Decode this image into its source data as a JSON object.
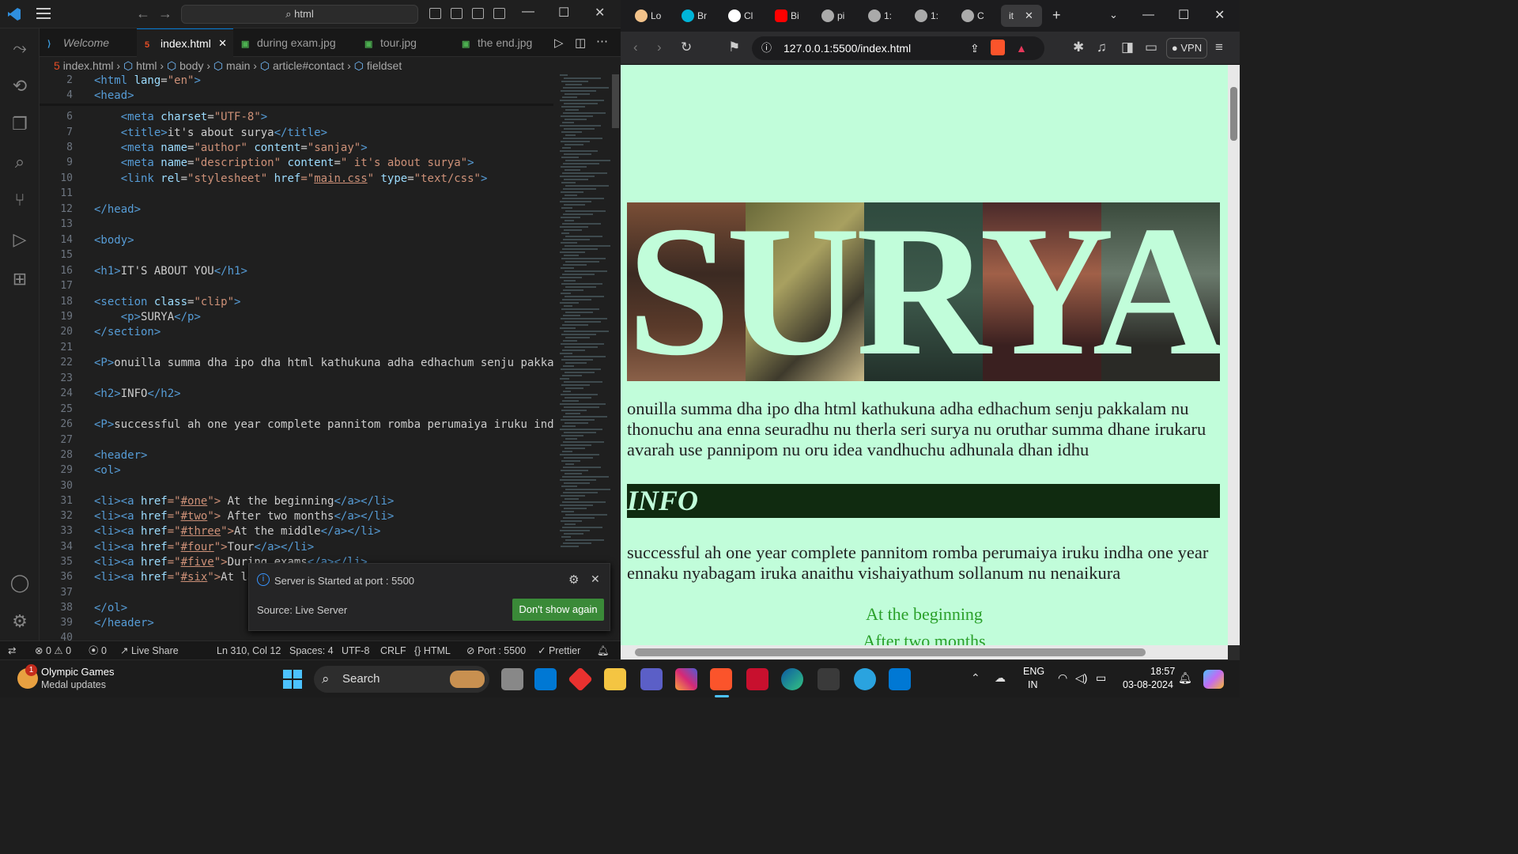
{
  "vscode": {
    "search_text": "html",
    "tabs": [
      {
        "label": "Welcome",
        "icon": "vscode-icon"
      },
      {
        "label": "index.html",
        "icon": "html5-icon",
        "active": true
      },
      {
        "label": "during exam.jpg",
        "icon": "image-icon"
      },
      {
        "label": "tour.jpg",
        "icon": "image-icon"
      },
      {
        "label": "the end.jpg",
        "icon": "image-icon"
      }
    ],
    "breadcrumbs": [
      "index.html",
      "html",
      "body",
      "main",
      "article#contact",
      "fieldset"
    ],
    "line_numbers": [
      "2",
      "4",
      "6",
      "7",
      "8",
      "9",
      "10",
      "11",
      "12",
      "13",
      "14",
      "15",
      "16",
      "17",
      "18",
      "19",
      "20",
      "21",
      "22",
      "23",
      "24",
      "25",
      "26",
      "27",
      "28",
      "29",
      "30",
      "31",
      "32",
      "33",
      "34",
      "35",
      "36",
      "37",
      "38",
      "39",
      "40"
    ],
    "code": {
      "l2": {
        "a": "<html ",
        "b": "lang",
        "c": "=",
        "d": "\"en\"",
        "e": ">"
      },
      "l4": "<head>",
      "l6": {
        "a": "    <meta ",
        "b": "charset",
        "c": "=",
        "d": "\"UTF-8\"",
        "e": ">"
      },
      "l7": {
        "a": "    <title>",
        "b": "it's about surya",
        "c": "</title>"
      },
      "l8": {
        "a": "    <meta ",
        "b": "name",
        "c": "=",
        "d": "\"author\"",
        "e": " content",
        "f": "=",
        "g": "\"sanjay\"",
        "h": ">"
      },
      "l9": {
        "a": "    <meta ",
        "b": "name",
        "c": "=",
        "d": "\"description\"",
        "e": " content",
        "f": "=",
        "g": "\" it's about surya\"",
        "h": ">"
      },
      "l10": {
        "a": "    <link ",
        "b": "rel",
        "c": "=",
        "d": "\"stylesheet\"",
        "e": " href",
        "f": "=\"",
        "g": "main.css",
        "h": "\"",
        "i": " type",
        "j": "=",
        "k": "\"text/css\"",
        "l": ">"
      },
      "l12": "</head>",
      "l14": "<body>",
      "l16": {
        "a": "<h1>",
        "b": "IT'S ABOUT YOU",
        "c": "</h1>"
      },
      "l18": {
        "a": "<section ",
        "b": "class",
        "c": "=",
        "d": "\"clip\"",
        "e": ">"
      },
      "l19": {
        "a": "    <p>",
        "b": "SURYA",
        "c": "</p>"
      },
      "l20": "</section>",
      "l22": {
        "a": "<P>",
        "b": "onuilla summa dha ipo dha html kathukuna adha edhachum senju pakkalam nu"
      },
      "l24": {
        "a": "<h2>",
        "b": "INFO",
        "c": "</h2>"
      },
      "l26": {
        "a": "<P>",
        "b": "successful ah one year complete pannitom romba perumaiya iruku indha one"
      },
      "l28": "<header>",
      "l29": "<ol>",
      "l31": {
        "a": "<li><a ",
        "b": "href",
        "c": "=\"",
        "d": "#one",
        "e": "\">",
        "f": " At the beginning",
        "g": "</a></li>"
      },
      "l32": {
        "a": "<li><a ",
        "b": "href",
        "c": "=\"",
        "d": "#two",
        "e": "\">",
        "f": " After two months",
        "g": "</a></li>"
      },
      "l33": {
        "a": "<li><a ",
        "b": "href",
        "c": "=\"",
        "d": "#three",
        "e": "\">",
        "f": "At the middle",
        "g": "</a></li>"
      },
      "l34": {
        "a": "<li><a ",
        "b": "href",
        "c": "=\"",
        "d": "#four",
        "e": "\">",
        "f": "Tour",
        "g": "</a></li>"
      },
      "l35": {
        "a": "<li><a ",
        "b": "href",
        "c": "=\"",
        "d": "#five",
        "e": "\">",
        "f": "During exams",
        "g": "</a></li>"
      },
      "l36": {
        "a": "<li><a ",
        "b": "href",
        "c": "=\"",
        "d": "#six",
        "e": "\">",
        "f": "At las"
      },
      "l38": "</ol>",
      "l39": "</header>"
    },
    "toast": {
      "message": "Server is Started at port : 5500",
      "source": "Source: Live Server",
      "button": "Don't show again"
    },
    "status": {
      "errors": "0",
      "warnings": "0",
      "ports": "0",
      "live_share": "Live Share",
      "position": "Ln 310, Col 12",
      "spaces": "Spaces: 4",
      "encoding": "UTF-8",
      "eol": "CRLF",
      "language": "HTML",
      "port": "Port : 5500",
      "prettier": "Prettier"
    }
  },
  "browser": {
    "tabs": [
      {
        "label": "Lo",
        "color": "#f2c28a"
      },
      {
        "label": "Br",
        "color": "#00b4d8"
      },
      {
        "label": "Cl",
        "color": "#ffffff"
      },
      {
        "label": "Bi",
        "color": "#ff0000"
      },
      {
        "label": "pi",
        "color": "#cccccc"
      },
      {
        "label": "1:",
        "color": "#cccccc"
      },
      {
        "label": "1:",
        "color": "#cccccc"
      },
      {
        "label": "C",
        "color": "#cccccc"
      },
      {
        "label": "it",
        "color": "#3a3a3c",
        "active": true
      }
    ],
    "url": "127.0.0.1:5500/index.html",
    "vpn": "VPN",
    "page": {
      "clip_text": "SURYA",
      "para1": "onuilla summa dha ipo dha html kathukuna adha edhachum senju pakkalam nu thonuchu ana enna seuradhu nu therla seri surya nu oruthar summa dhane irukaru avarah use pannipom nu oru idea vandhuchu adhunala dhan idhu",
      "info": "INFO",
      "para2": "successful ah one year complete pannitom romba perumaiya iruku indha one year ennaku nyabagam iruka anaithu vishaiyathum sollanum nu nenaikura",
      "links": [
        "At the beginning",
        "After two months"
      ]
    }
  },
  "taskbar": {
    "news_title": "Olympic Games",
    "news_sub": "Medal updates",
    "badge": "1",
    "search": "Search",
    "lang_top": "ENG",
    "lang_bottom": "IN",
    "time": "18:57",
    "date": "03-08-2024"
  }
}
